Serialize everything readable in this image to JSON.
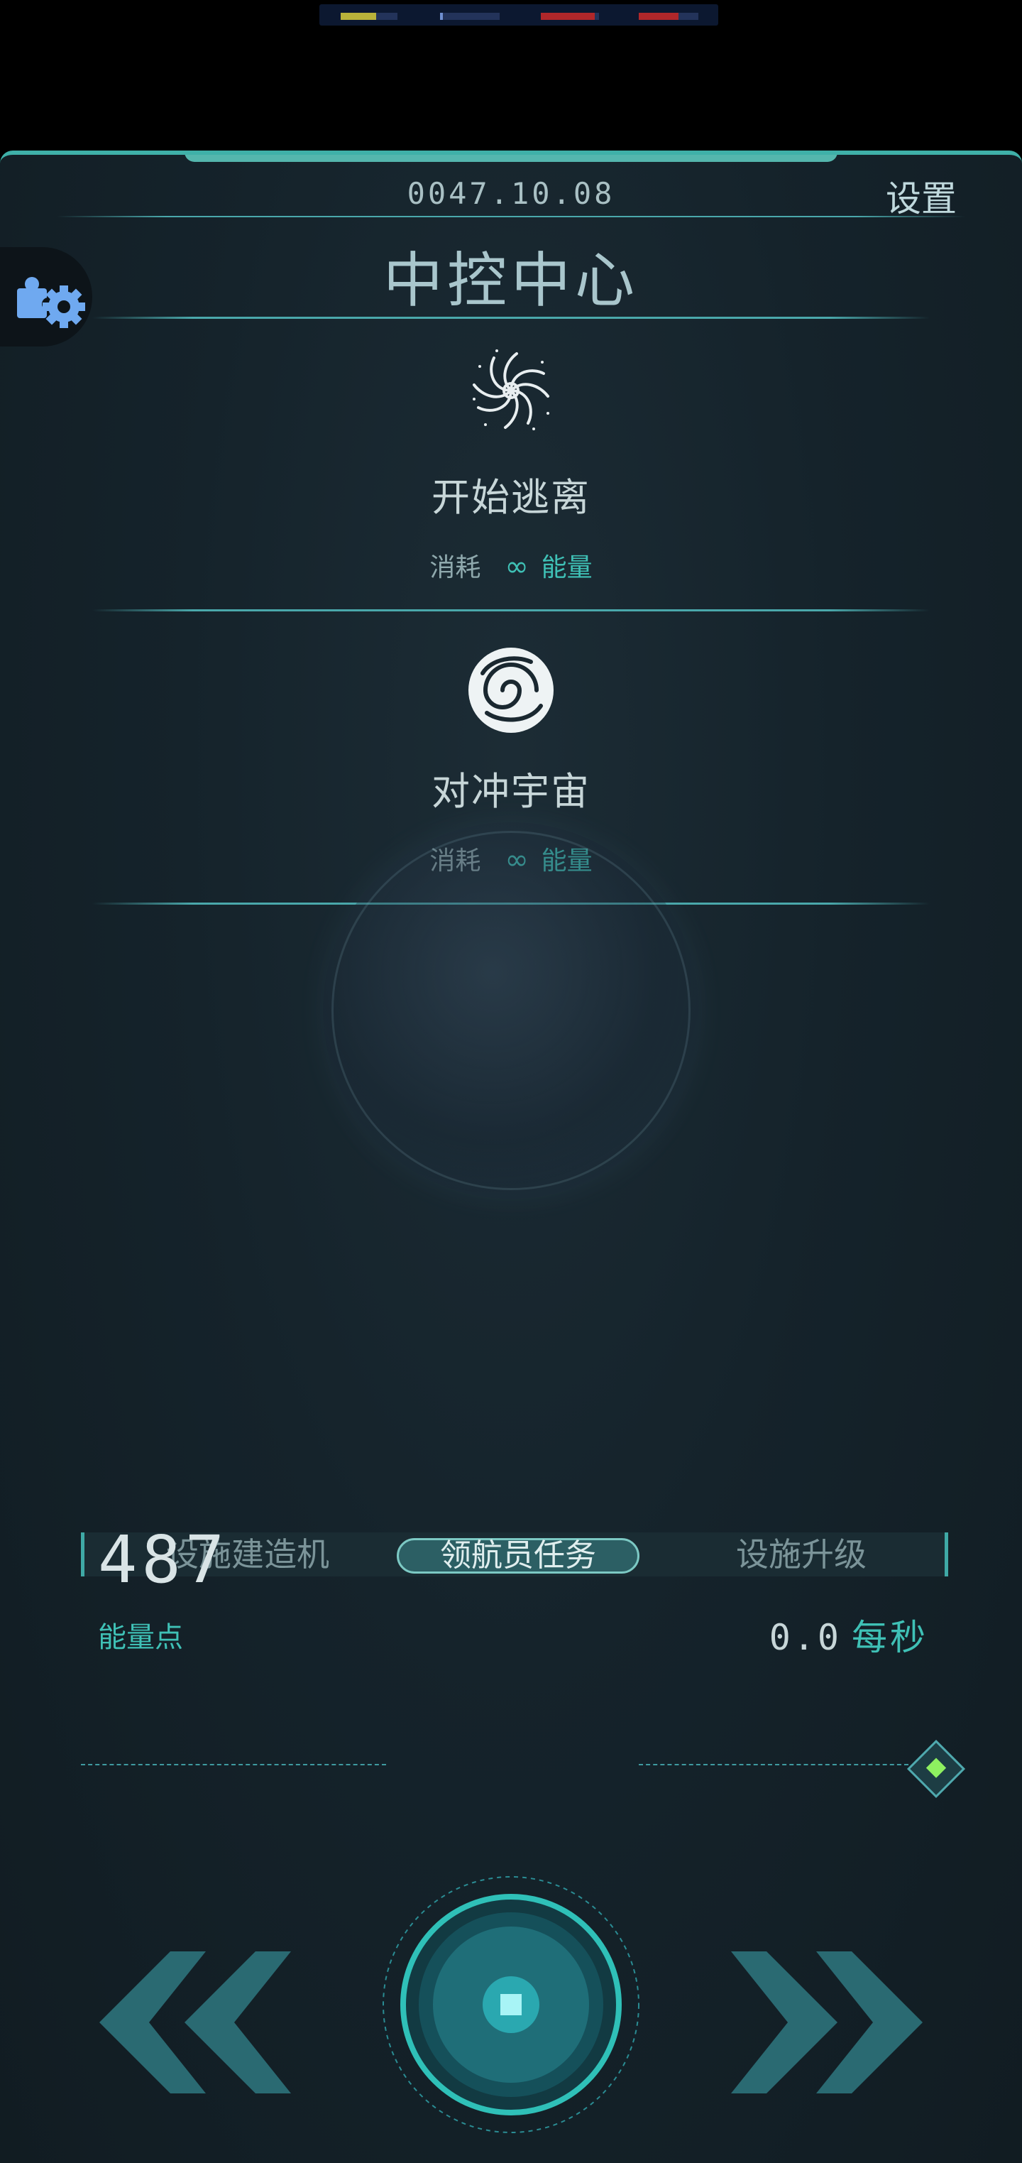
{
  "resource_bar": {
    "segments": [
      {
        "name": "resource-yellow",
        "color": "#b9b23a",
        "fill": 0.5
      },
      {
        "name": "resource-blue",
        "color": "#3a5a9a",
        "fill": 0.05
      },
      {
        "name": "resource-red-1",
        "color": "#b0272a",
        "fill": 0.8
      },
      {
        "name": "resource-red-2",
        "color": "#b0272a",
        "fill": 0.7
      }
    ]
  },
  "header": {
    "date": "0047.10.08",
    "settings_label": "设置",
    "title": "中控中心"
  },
  "actions": [
    {
      "name": "开始逃离",
      "cost_label": "消耗",
      "cost_value": "∞",
      "cost_unit": "能量",
      "icon": "vortex-icon"
    },
    {
      "name": "对冲宇宙",
      "cost_label": "消耗",
      "cost_value": "∞",
      "cost_unit": "能量",
      "icon": "swirl-orb-icon"
    }
  ],
  "tabs": [
    {
      "label": "设施建造机",
      "active": false
    },
    {
      "label": "领航员任务",
      "active": true
    },
    {
      "label": "设施升级",
      "active": false
    }
  ],
  "stats": {
    "energy_points": "487",
    "energy_label": "能量点",
    "rate_value": "0.0",
    "rate_unit": "每秒"
  },
  "colors": {
    "accent": "#3fc1b6",
    "panel_bg": "#15232b",
    "indicator": "#8ef060"
  }
}
